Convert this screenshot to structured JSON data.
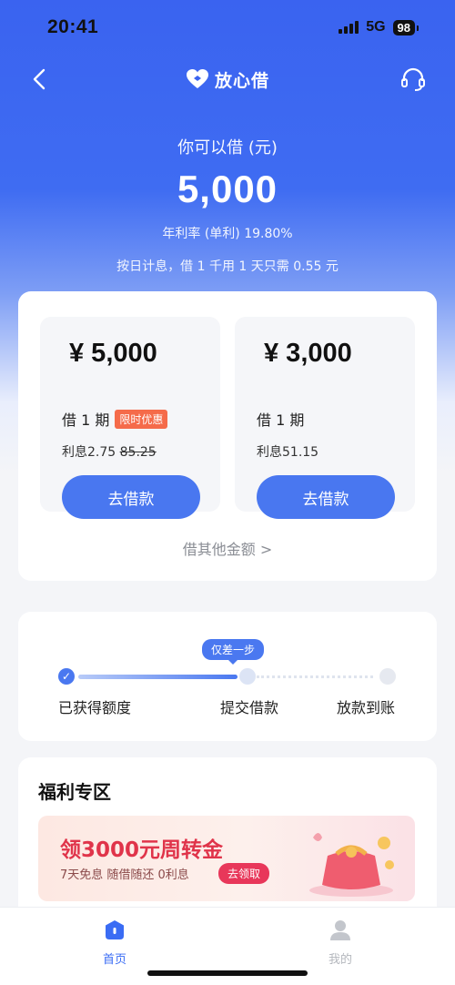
{
  "status_bar": {
    "time": "20:41",
    "network": "5G",
    "battery": "98"
  },
  "nav": {
    "title": "放心借",
    "back_icon": "chevron-left-icon",
    "service_icon": "headset-icon"
  },
  "hero": {
    "label": "你可以借 (元)",
    "amount": "5,000",
    "rate": "年利率 (单利) 19.80%",
    "note": "按日计息，借 1 千用 1 天只需 0.55 元"
  },
  "loan_options": [
    {
      "amount": "¥ 5,000",
      "term": "借 1 期",
      "badge": "限时优惠",
      "interest_label": "利息2.75",
      "interest_original": "85.25",
      "button": "去借款"
    },
    {
      "amount": "¥ 3,000",
      "term": "借 1 期",
      "interest_label": "利息51.15",
      "button": "去借款"
    }
  ],
  "other_amount": "借其他金额 >",
  "steps": {
    "tip": "仅差一步",
    "items": [
      "已获得额度",
      "提交借款",
      "放款到账"
    ],
    "check": "✓"
  },
  "welfare": {
    "title": "福利专区",
    "promo_title": "领3000元周转金",
    "promo_sub": "7天免息 随借随还 0利息",
    "promo_button": "去领取"
  },
  "tabbar": {
    "home": "首页",
    "mine": "我的"
  },
  "colors": {
    "primary": "#3a63f0",
    "button": "#4977f0",
    "badge": "#f56b4a",
    "promo_red": "#e0344a"
  }
}
